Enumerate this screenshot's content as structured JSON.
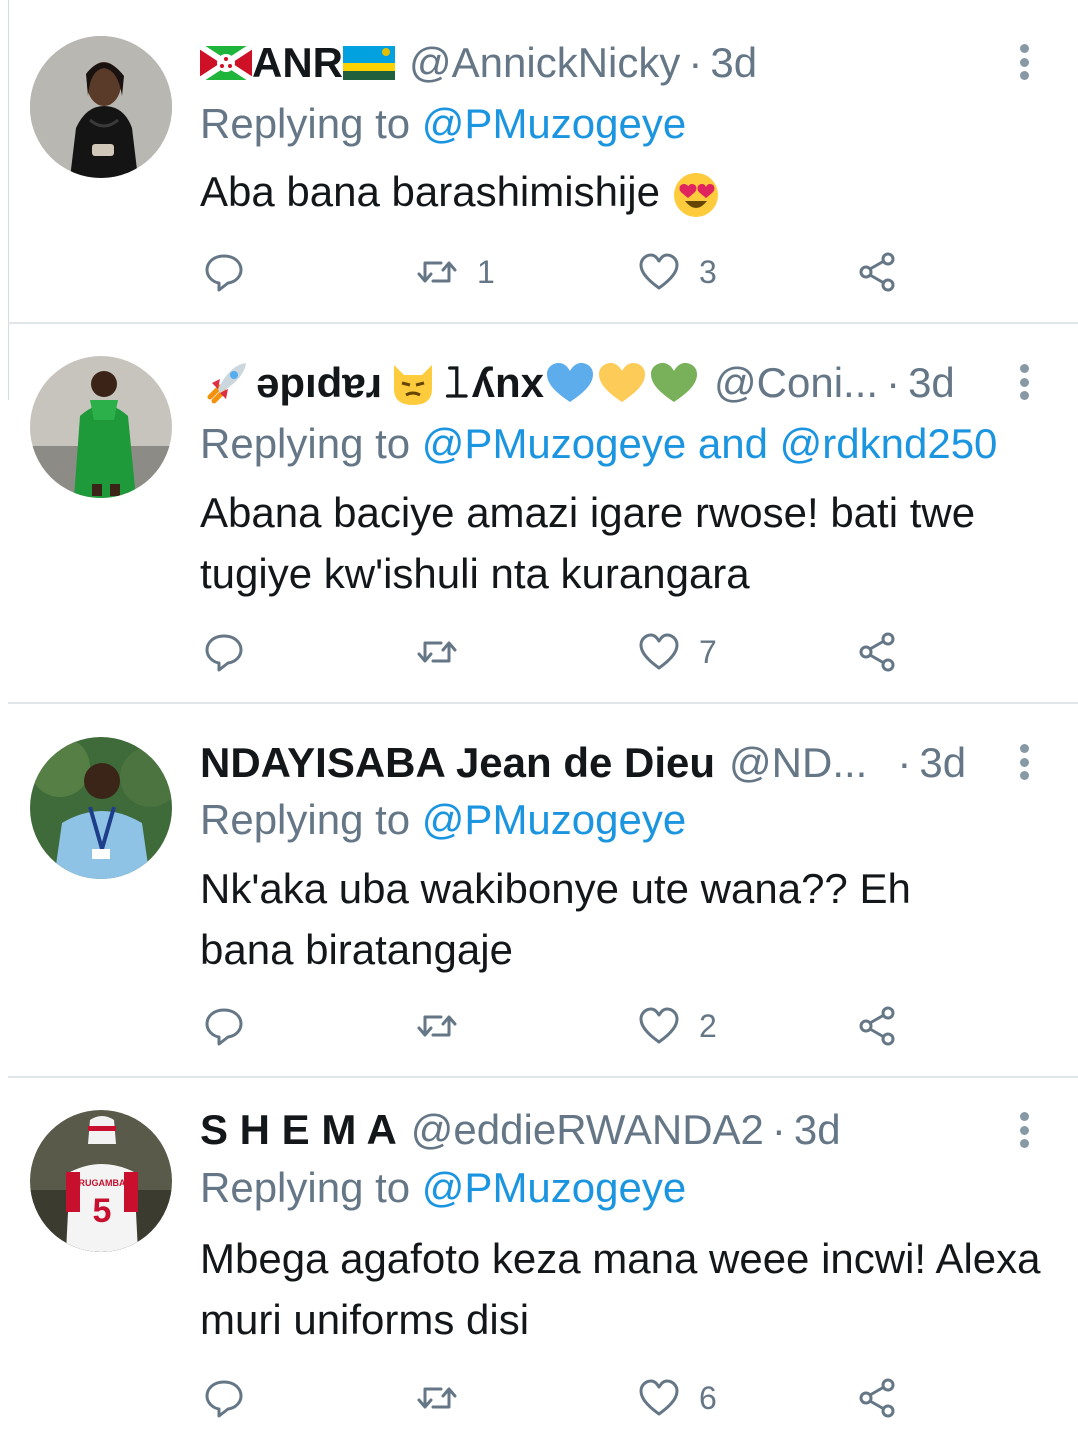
{
  "tweets": [
    {
      "name": "ANR",
      "handle": "@AnnickNicky",
      "time": "3d",
      "replying_label": "Replying to",
      "mentions": "@PMuzogeye",
      "text": "Aba bana barashimishije",
      "emoji_end": "heart-eyes-emoji",
      "reply_count": "",
      "retweet_count": "1",
      "like_count": "3"
    },
    {
      "name": "𝚕ʎnx",
      "name_prefix": "ǝpıdɐɹ",
      "handle": "@Coni...",
      "time": "3d",
      "replying_label": "Replying to",
      "mentions": "@PMuzogeye and @rdknd250",
      "text": "Abana baciye amazi igare rwose! bati twe tugiye kw'ishuli nta kurangara",
      "reply_count": "",
      "retweet_count": "",
      "like_count": "7"
    },
    {
      "name": "NDAYISABA Jean de Dieu",
      "handle": "@ND...",
      "time": "3d",
      "replying_label": "Replying to",
      "mentions": "@PMuzogeye",
      "text": "Nk'aka uba wakibonye ute wana?? Eh bana biratangaje",
      "reply_count": "",
      "retweet_count": "",
      "like_count": "2"
    },
    {
      "name": "S H E M A",
      "handle": "@eddieRWANDA2",
      "time": "3d",
      "replying_label": "Replying to",
      "mentions": "@PMuzogeye",
      "text": "Mbega agafoto keza mana weee incwi! Alexa muri uniforms disi",
      "reply_count": "",
      "retweet_count": "",
      "like_count": "6"
    }
  ],
  "separator": "·",
  "colors": {
    "link": "#1b95e0",
    "muted": "#657786",
    "text": "#14171a",
    "divider": "#e1e6ea"
  },
  "icons": [
    "reply-icon",
    "retweet-icon",
    "like-icon",
    "share-icon",
    "more-options-icon"
  ]
}
